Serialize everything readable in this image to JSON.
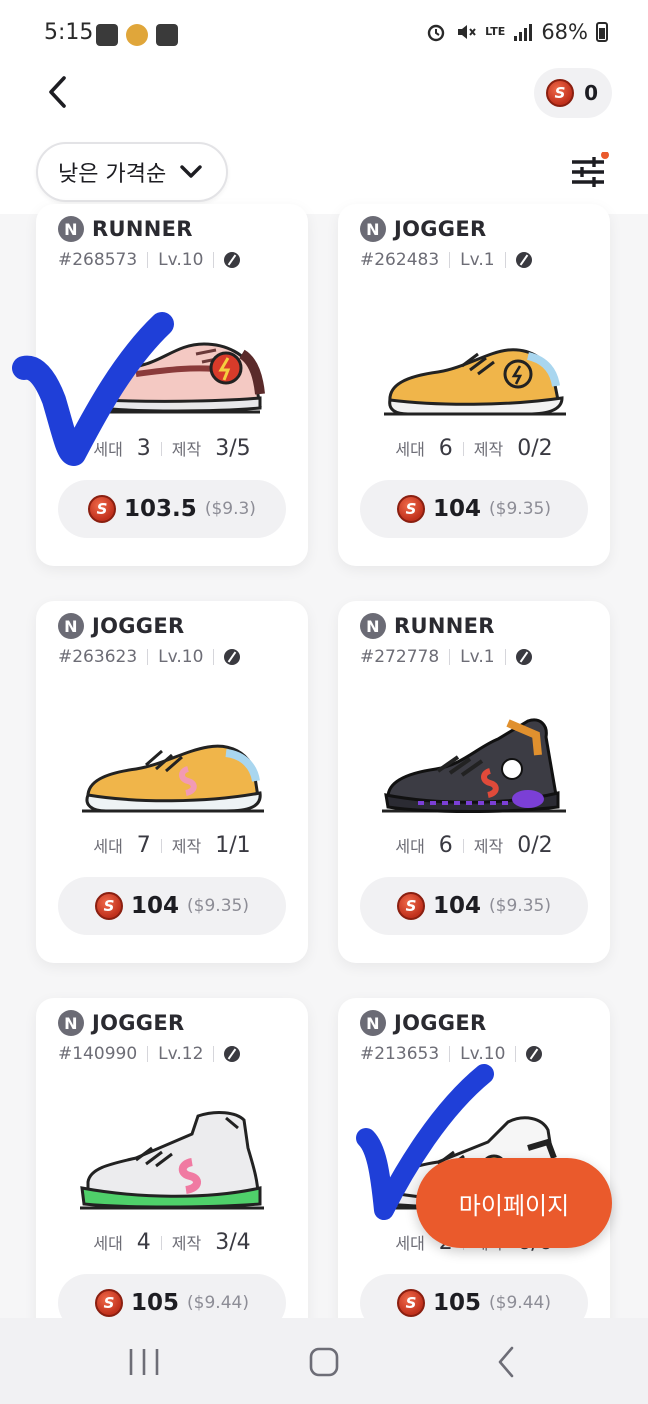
{
  "status_bar": {
    "time": "5:15",
    "network": "LTE",
    "battery": "68%"
  },
  "header": {
    "coin_balance": "0",
    "sort_label": "낮은 가격순"
  },
  "cards": [
    {
      "type": "RUNNER",
      "id": "#268573",
      "level": "Lv.10",
      "gen_label": "세대",
      "gen": "3",
      "craft_label": "제작",
      "craft": "3/5",
      "price": "103.5",
      "usd": "($9.3)",
      "shoe": "pink-runner"
    },
    {
      "type": "JOGGER",
      "id": "#262483",
      "level": "Lv.1",
      "gen_label": "세대",
      "gen": "6",
      "craft_label": "제작",
      "craft": "0/2",
      "price": "104",
      "usd": "($9.35)",
      "shoe": "orange-jogger"
    },
    {
      "type": "JOGGER",
      "id": "#263623",
      "level": "Lv.10",
      "gen_label": "세대",
      "gen": "7",
      "craft_label": "제작",
      "craft": "1/1",
      "price": "104",
      "usd": "($9.35)",
      "shoe": "yellow-jogger"
    },
    {
      "type": "RUNNER",
      "id": "#272778",
      "level": "Lv.1",
      "gen_label": "세대",
      "gen": "6",
      "craft_label": "제작",
      "craft": "0/2",
      "price": "104",
      "usd": "($9.35)",
      "shoe": "black-runner"
    },
    {
      "type": "JOGGER",
      "id": "#140990",
      "level": "Lv.12",
      "gen_label": "세대",
      "gen": "4",
      "craft_label": "제작",
      "craft": "3/4",
      "price": "105",
      "usd": "($9.44)",
      "shoe": "green-jogger"
    },
    {
      "type": "JOGGER",
      "id": "#213653",
      "level": "Lv.10",
      "gen_label": "세대",
      "gen": "2",
      "craft_label": "제작",
      "craft": "6/6",
      "price": "105",
      "usd": "($9.44)",
      "shoe": "white-jogger"
    }
  ],
  "fab_label": "마이페이지",
  "colors": {
    "accent": "#ea5a2c",
    "coin": "#c0301c",
    "check_mark": "#1f3fd8"
  }
}
